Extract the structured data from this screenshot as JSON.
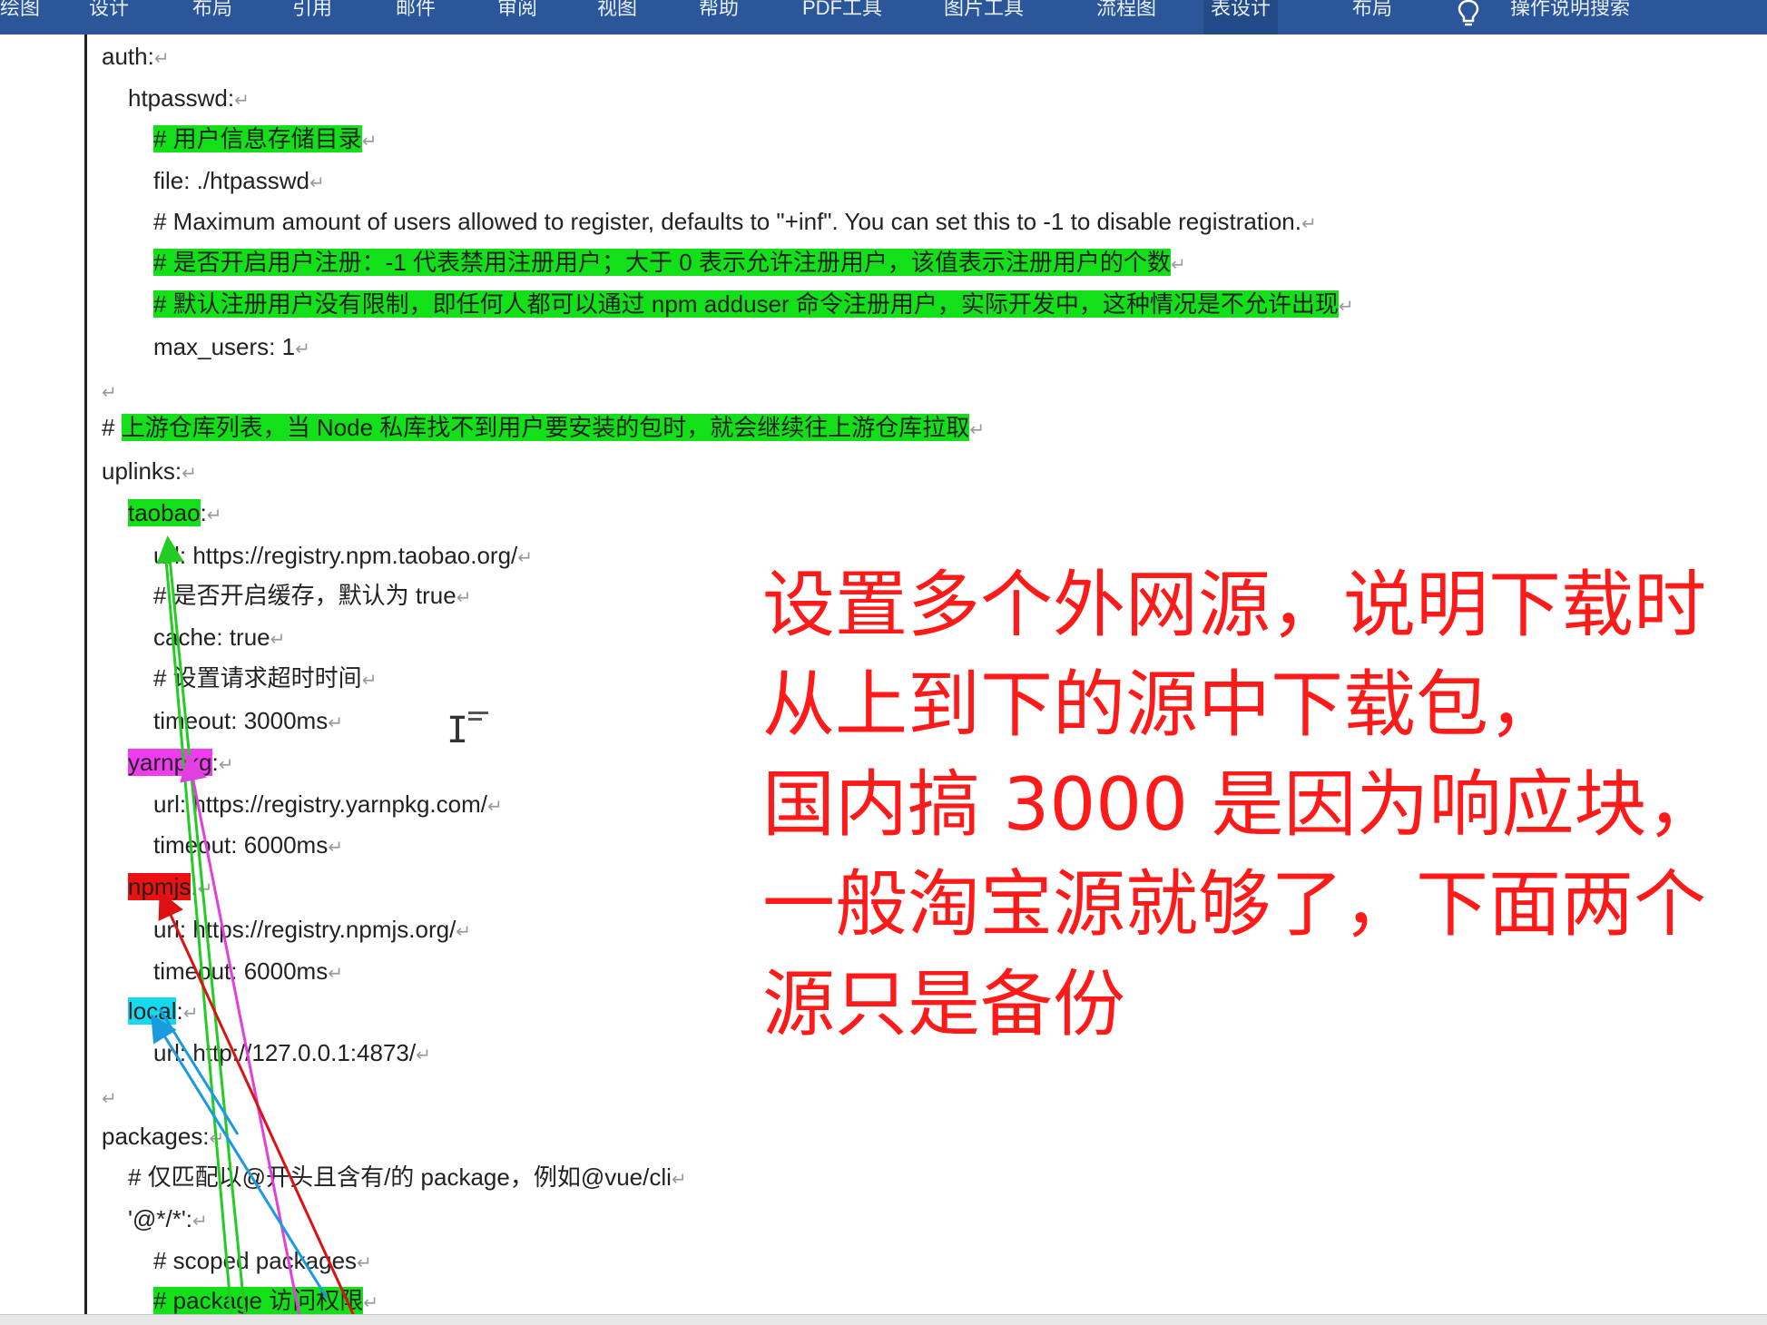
{
  "ribbon": {
    "tabs": [
      "绘图",
      "设计",
      "布局",
      "引用",
      "邮件",
      "审阅",
      "视图",
      "帮助",
      "PDF工具",
      "图片工具",
      "流程图",
      "表设计",
      "布局"
    ],
    "search_label": "操作说明搜索"
  },
  "document": {
    "lines": [
      {
        "text": "auth:"
      },
      {
        "text": "htpasswd:"
      },
      {
        "text": "# 用户信息存储目录"
      },
      {
        "text": "file: ./htpasswd"
      },
      {
        "text": "# Maximum amount of users allowed to register, defaults to \"+inf\". You can set this to -1 to disable registration."
      },
      {
        "text": "# 是否开启用户注册：-1 代表禁用注册用户；大于 0 表示允许注册用户，该值表示注册用户的个数"
      },
      {
        "text": "# 默认注册用户没有限制，即任何人都可以通过  npm adduser  命令注册用户，实际开发中，这种情况是不允许出现"
      },
      {
        "text": "max_users: 1"
      },
      {
        "text": ""
      },
      {
        "text": "#",
        "hl": "上游仓库列表，当 Node 私库找不到用户要安装的包时，就会继续往上游仓库拉取"
      },
      {
        "text": "uplinks:"
      },
      {
        "text": "taobao",
        "suffix": ":"
      },
      {
        "text": "url: https://registry.npm.taobao.org/"
      },
      {
        "text": "#  是否开启缓存，默认为 true"
      },
      {
        "text": "cache: true"
      },
      {
        "text": "#  设置请求超时时间"
      },
      {
        "text": "timeout: 3000ms"
      },
      {
        "text": "yarnpkg",
        "suffix": ":"
      },
      {
        "text": "url: https://registry.yarnpkg.com/"
      },
      {
        "text": "timeout: 6000ms"
      },
      {
        "text": "npmjs",
        "suffix": ":"
      },
      {
        "text": "url: https://registry.npmjs.org/"
      },
      {
        "text": "timeout: 6000ms"
      },
      {
        "text": "local",
        "suffix": ":"
      },
      {
        "text": "url: http://127.0.0.1:4873/"
      },
      {
        "text": ""
      },
      {
        "text": "packages:"
      },
      {
        "text": "# 仅匹配以@开头且含有/的 package，例如@vue/cli"
      },
      {
        "text": "'@*/*':"
      },
      {
        "text": "# scoped packages"
      },
      {
        "text": "# package 访问权限"
      }
    ]
  },
  "annotation": {
    "lines": [
      "设置多个外网源，说明下载时",
      "从上到下的源中下载包，",
      "国内搞 3000 是因为响应块，",
      "一般淘宝源就够了，下面两个",
      "源只是备份"
    ]
  },
  "colors": {
    "ribbon": "#2b579a",
    "highlight_green": "#14e01a",
    "highlight_magenta": "#f03cf0",
    "highlight_red": "#ee1111",
    "highlight_cyan": "#18d8f0",
    "annotation_text": "#ff1a1a"
  }
}
